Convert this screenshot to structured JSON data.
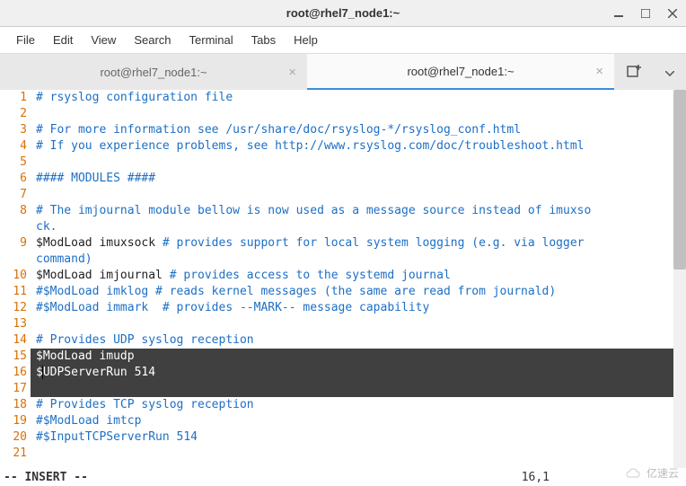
{
  "window": {
    "title": "root@rhel7_node1:~"
  },
  "menu": {
    "items": [
      "File",
      "Edit",
      "View",
      "Search",
      "Terminal",
      "Tabs",
      "Help"
    ]
  },
  "tabs": [
    {
      "label": "root@rhel7_node1:~",
      "active": false
    },
    {
      "label": "root@rhel7_node1:~",
      "active": true
    }
  ],
  "lines": [
    {
      "n": "1",
      "segs": [
        {
          "c": "comment",
          "t": "# rsyslog configuration file"
        }
      ]
    },
    {
      "n": "2",
      "segs": []
    },
    {
      "n": "3",
      "segs": [
        {
          "c": "comment",
          "t": "# For more information see /usr/share/doc/rsyslog-*/rsyslog_conf.html"
        }
      ]
    },
    {
      "n": "4",
      "segs": [
        {
          "c": "comment",
          "t": "# If you experience problems, see http://www.rsyslog.com/doc/troubleshoot.html"
        }
      ]
    },
    {
      "n": "5",
      "segs": []
    },
    {
      "n": "6",
      "segs": [
        {
          "c": "comment",
          "t": "#### MODULES ####"
        }
      ]
    },
    {
      "n": "7",
      "segs": []
    },
    {
      "n": "8",
      "segs": [
        {
          "c": "comment",
          "t": "# The imjournal module bellow is now used as a message source instead of imuxso"
        }
      ]
    },
    {
      "n": "",
      "segs": [
        {
          "c": "comment",
          "t": "ck."
        }
      ]
    },
    {
      "n": "9",
      "segs": [
        {
          "c": "normal",
          "t": "$ModLoad imuxsock "
        },
        {
          "c": "comment",
          "t": "# provides support for local system logging (e.g. via logger "
        }
      ]
    },
    {
      "n": "",
      "segs": [
        {
          "c": "comment",
          "t": "command)"
        }
      ]
    },
    {
      "n": "10",
      "segs": [
        {
          "c": "normal",
          "t": "$ModLoad imjournal "
        },
        {
          "c": "comment",
          "t": "# provides access to the systemd journal"
        }
      ]
    },
    {
      "n": "11",
      "segs": [
        {
          "c": "comment",
          "t": "#$ModLoad imklog # reads kernel messages (the same are read from journald)"
        }
      ]
    },
    {
      "n": "12",
      "segs": [
        {
          "c": "comment",
          "t": "#$ModLoad immark  # provides --MARK-- message capability"
        }
      ]
    },
    {
      "n": "13",
      "segs": []
    },
    {
      "n": "14",
      "segs": [
        {
          "c": "comment",
          "t": "# Provides UDP syslog reception"
        }
      ]
    },
    {
      "n": "15",
      "segs": [
        {
          "c": "normal",
          "t": "$ModLoad imudp"
        }
      ],
      "sel": true
    },
    {
      "n": "16",
      "segs": [
        {
          "c": "normal",
          "t": "$UDPServerRun 514"
        }
      ],
      "sel": true,
      "cursor": true
    },
    {
      "n": "17",
      "segs": [],
      "sel": true
    },
    {
      "n": "18",
      "segs": [
        {
          "c": "comment",
          "t": "# Provides TCP syslog reception"
        }
      ]
    },
    {
      "n": "19",
      "segs": [
        {
          "c": "comment",
          "t": "#$ModLoad imtcp"
        }
      ]
    },
    {
      "n": "20",
      "segs": [
        {
          "c": "comment",
          "t": "#$InputTCPServerRun 514"
        }
      ]
    },
    {
      "n": "21",
      "segs": []
    }
  ],
  "status": {
    "mode": "-- INSERT --",
    "position": "16,1"
  },
  "watermark": {
    "text": "亿速云"
  }
}
